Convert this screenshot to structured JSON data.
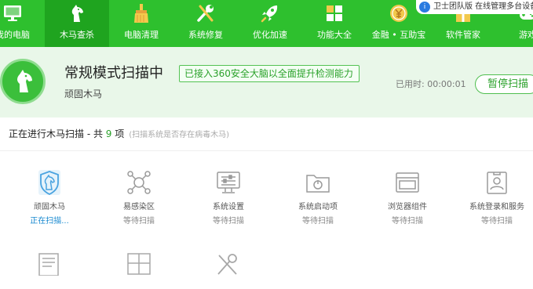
{
  "nav": {
    "items": [
      {
        "label": "我的电脑",
        "icon": "monitor-icon"
      },
      {
        "label": "木马查杀",
        "icon": "horse-icon"
      },
      {
        "label": "电脑清理",
        "icon": "broom-icon"
      },
      {
        "label": "系统修复",
        "icon": "wrench-screwdriver-icon"
      },
      {
        "label": "优化加速",
        "icon": "rocket-icon"
      },
      {
        "label": "功能大全",
        "icon": "grid-icon"
      },
      {
        "label": "金融 • 互助宝",
        "icon": "coin-icon"
      },
      {
        "label": "软件管家",
        "icon": "gift-icon"
      },
      {
        "label": "游戏",
        "icon": "game-icon"
      }
    ],
    "notice": "卫士团队版 在线管理多台设备"
  },
  "header": {
    "title": "常规模式扫描中",
    "badge": "已接入360安全大脑以全面提升检测能力",
    "subtitle": "顽固木马",
    "elapsed": "已用时:  00:00:01",
    "pause_button": "暂停扫描"
  },
  "progress": {
    "prefix": "正在进行木马扫描 - 共 ",
    "count": "9",
    "suffix": " 项",
    "hint": "(扫描系统是否存在病毒木马)"
  },
  "scan_items": [
    {
      "name": "顽固木马",
      "status": "正在扫描...",
      "icon": "shield-horse-icon"
    },
    {
      "name": "易感染区",
      "status": "等待扫描",
      "icon": "network-nodes-icon"
    },
    {
      "name": "系统设置",
      "status": "等待扫描",
      "icon": "settings-monitor-icon"
    },
    {
      "name": "系统启动项",
      "status": "等待扫描",
      "icon": "startup-folder-icon"
    },
    {
      "name": "浏览器组件",
      "status": "等待扫描",
      "icon": "browser-window-icon"
    },
    {
      "name": "系统登录和服务",
      "status": "等待扫描",
      "icon": "user-badge-icon"
    }
  ],
  "colors": {
    "brand_green": "#2ec02e",
    "active_green": "#1fa41f",
    "header_bg": "#e9f7e9",
    "scanning_blue": "#1a8ad0"
  }
}
